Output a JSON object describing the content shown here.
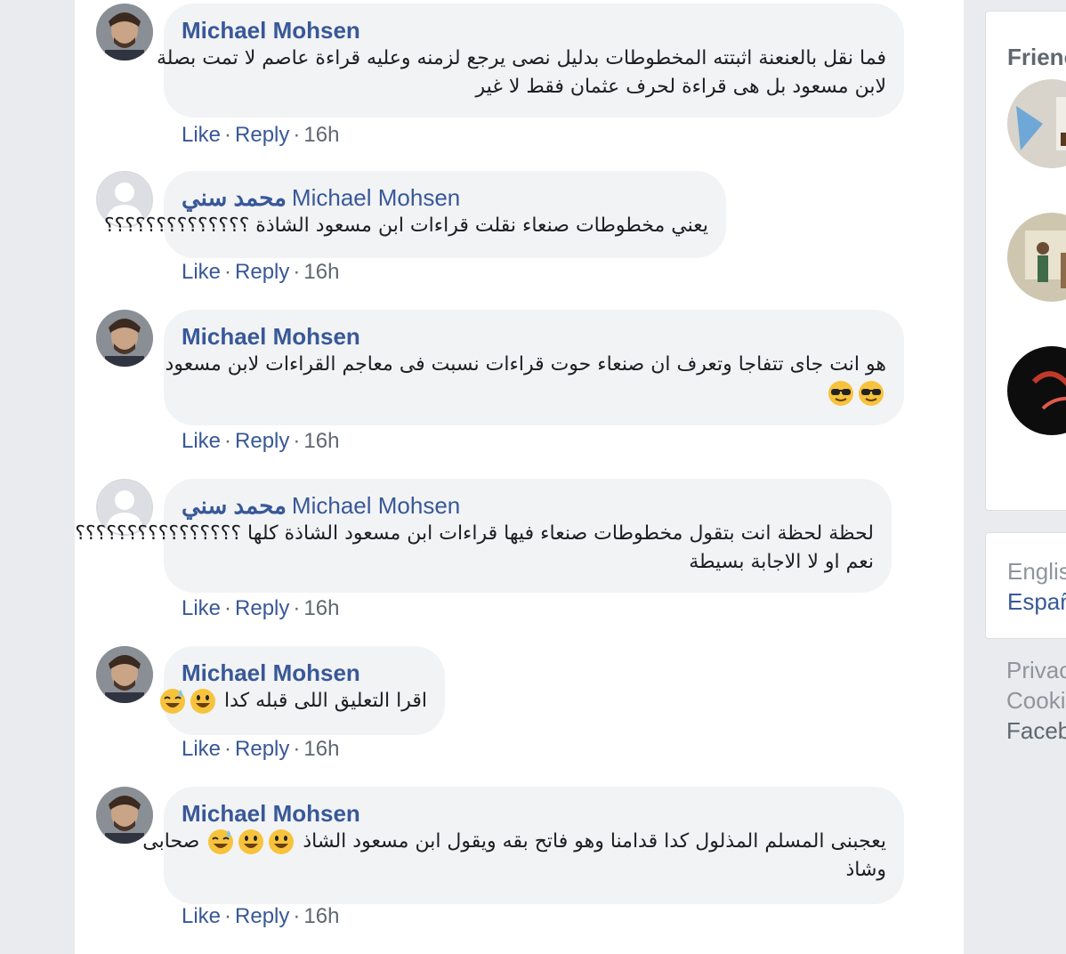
{
  "actions": {
    "like": "Like",
    "reply": "Reply",
    "separator": "·"
  },
  "comments": [
    {
      "author": "Michael Mohsen",
      "mention": "",
      "avatar": "profile-photo",
      "lines": [
        "فما نقل بالعنعنة اثبتته المخطوطات بدليل نصى يرجع لزمنه وعليه قراءة عاصم لا تمت بصلة",
        "لابن مسعود بل هى قراءة لحرف عثمان فقط لا غير"
      ],
      "time": "16h"
    },
    {
      "author": "محمد سني",
      "mention": "Michael Mohsen",
      "avatar": "default-profile",
      "lines": [
        "يعني مخطوطات صنعاء نقلت قراءات ابن مسعود الشاذة ؟؟؟؟؟؟؟؟؟؟؟؟؟؟"
      ],
      "time": "16h"
    },
    {
      "author": "Michael Mohsen",
      "mention": "",
      "avatar": "profile-photo",
      "lines": [
        "هو انت جاى تتفاجا وتعرف ان صنعاء حوت قراءات نسبت فى معاجم القراءات لابن مسعود"
      ],
      "emoji_line": [
        "sunglasses-emoji",
        "sunglasses-emoji"
      ],
      "time": "16h"
    },
    {
      "author": "محمد سني",
      "mention": "Michael Mohsen",
      "avatar": "default-profile",
      "lines": [
        "لحظة لحظة انت بتقول مخطوطات صنعاء فيها قراءات ابن مسعود الشاذة كلها ؟؟؟؟؟؟؟؟؟؟؟؟؟؟؟؟",
        "نعم او لا الاجابة بسيطة"
      ],
      "time": "16h"
    },
    {
      "author": "Michael Mohsen",
      "mention": "",
      "avatar": "profile-photo",
      "lines": [
        "اقرا التعليق اللى قبله كدا"
      ],
      "inline_emojis": [
        "grinning-emoji",
        "sweat-smile-emoji"
      ],
      "time": "16h"
    },
    {
      "author": "Michael Mohsen",
      "mention": "",
      "avatar": "profile-photo",
      "lines": [
        "يعجبنى المسلم المذلول كدا قدامنا وهو فاتح بقه ويقول ابن مسعود الشاذ",
        "صحابى",
        "وشاذ"
      ],
      "inline_emojis": [
        "grinning-emoji",
        "grinning-emoji",
        "sweat-smile-emoji"
      ],
      "time": "16h"
    }
  ],
  "sidebar": {
    "friends_title": "Frienc",
    "languages": [
      "Englis",
      "Españ"
    ],
    "footer_links": [
      "Privac",
      "Cooki",
      "Faceb"
    ]
  },
  "colors": {
    "link": "#385898",
    "bubble": "#f2f3f5",
    "background": "#e9ebee",
    "meta": "#606770"
  }
}
